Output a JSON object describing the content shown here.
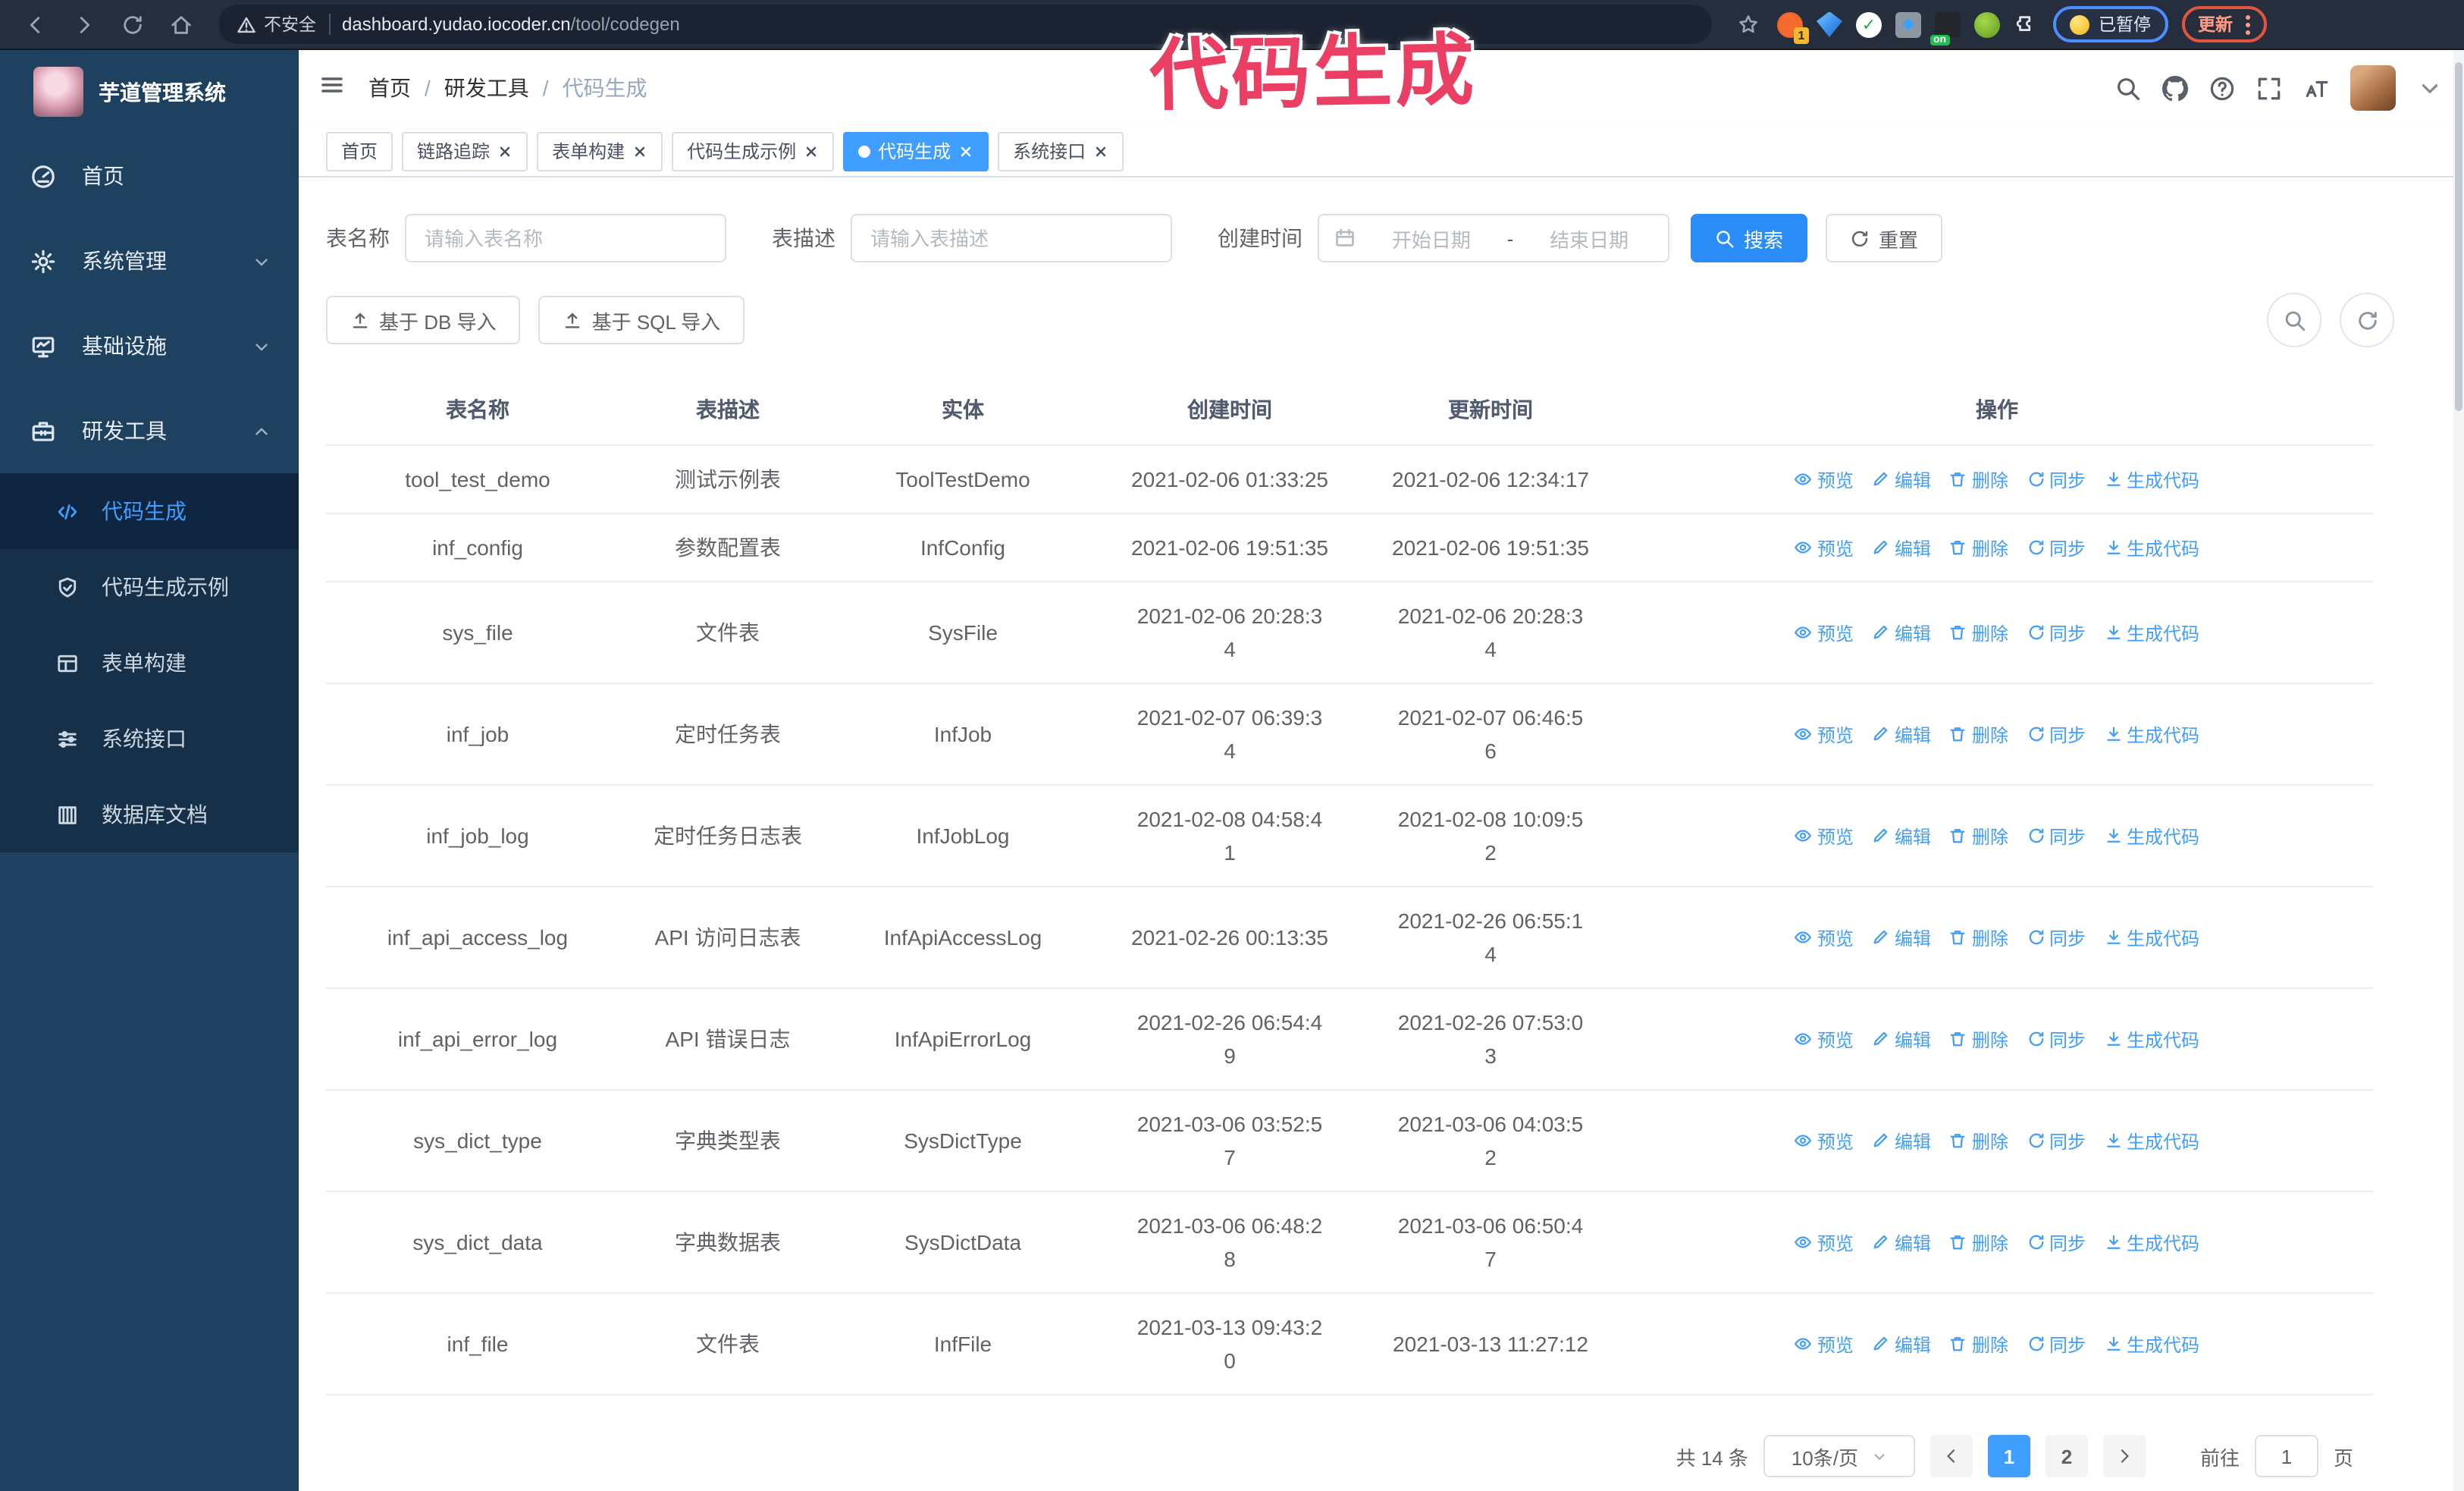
{
  "annotation": {
    "text": "代码生成"
  },
  "browser": {
    "security": "不安全",
    "url_domain": "dashboard.yudao.iocoder.cn",
    "url_path": "/tool/codegen",
    "ext_count_badge": "1",
    "ext_on_badge": "on",
    "paused_label": "已暂停",
    "update_label": "更新"
  },
  "sidebar": {
    "title": "芋道管理系统",
    "items": [
      {
        "label": "首页",
        "icon": "dashboard",
        "chevron": ""
      },
      {
        "label": "系统管理",
        "icon": "gear",
        "chevron": "down"
      },
      {
        "label": "基础设施",
        "icon": "monitor",
        "chevron": "down"
      },
      {
        "label": "研发工具",
        "icon": "toolbox",
        "chevron": "up"
      }
    ],
    "sub_items": [
      {
        "label": "代码生成",
        "icon": "code",
        "active": true
      },
      {
        "label": "代码生成示例",
        "icon": "shield",
        "active": false
      },
      {
        "label": "表单构建",
        "icon": "form",
        "active": false
      },
      {
        "label": "系统接口",
        "icon": "sliders",
        "active": false
      },
      {
        "label": "数据库文档",
        "icon": "database",
        "active": false
      }
    ]
  },
  "breadcrumb": {
    "items": [
      "首页",
      "研发工具",
      "代码生成"
    ],
    "separator": "/"
  },
  "tabs": [
    {
      "label": "首页",
      "closable": false,
      "active": false
    },
    {
      "label": "链路追踪",
      "closable": true,
      "active": false
    },
    {
      "label": "表单构建",
      "closable": true,
      "active": false
    },
    {
      "label": "代码生成示例",
      "closable": true,
      "active": false
    },
    {
      "label": "代码生成",
      "closable": true,
      "active": true
    },
    {
      "label": "系统接口",
      "closable": true,
      "active": false
    }
  ],
  "filters": {
    "name_label": "表名称",
    "name_placeholder": "请输入表名称",
    "desc_label": "表描述",
    "desc_placeholder": "请输入表描述",
    "time_label": "创建时间",
    "start_placeholder": "开始日期",
    "range_separator": "-",
    "end_placeholder": "结束日期",
    "search_label": "搜索",
    "reset_label": "重置"
  },
  "toolbar": {
    "db_import_label": "基于 DB 导入",
    "sql_import_label": "基于 SQL 导入"
  },
  "table": {
    "columns": [
      "表名称",
      "表描述",
      "实体",
      "创建时间",
      "更新时间",
      "操作"
    ],
    "actions": [
      "预览",
      "编辑",
      "删除",
      "同步",
      "生成代码"
    ],
    "rows": [
      {
        "name": "tool_test_demo",
        "desc": "测试示例表",
        "entity": "ToolTestDemo",
        "created": "2021-02-06 01:33:25",
        "updated": "2021-02-06 12:34:17"
      },
      {
        "name": "inf_config",
        "desc": "参数配置表",
        "entity": "InfConfig",
        "created": "2021-02-06 19:51:35",
        "updated": "2021-02-06 19:51:35"
      },
      {
        "name": "sys_file",
        "desc": "文件表",
        "entity": "SysFile",
        "created": "2021-02-06 20:28:3\n4",
        "updated": "2021-02-06 20:28:3\n4"
      },
      {
        "name": "inf_job",
        "desc": "定时任务表",
        "entity": "InfJob",
        "created": "2021-02-07 06:39:3\n4",
        "updated": "2021-02-07 06:46:5\n6"
      },
      {
        "name": "inf_job_log",
        "desc": "定时任务日志表",
        "entity": "InfJobLog",
        "created": "2021-02-08 04:58:4\n1",
        "updated": "2021-02-08 10:09:5\n2"
      },
      {
        "name": "inf_api_access_log",
        "desc": "API 访问日志表",
        "entity": "InfApiAccessLog",
        "created": "2021-02-26 00:13:35",
        "updated": "2021-02-26 06:55:1\n4"
      },
      {
        "name": "inf_api_error_log",
        "desc": "API 错误日志",
        "entity": "InfApiErrorLog",
        "created": "2021-02-26 06:54:4\n9",
        "updated": "2021-02-26 07:53:0\n3"
      },
      {
        "name": "sys_dict_type",
        "desc": "字典类型表",
        "entity": "SysDictType",
        "created": "2021-03-06 03:52:5\n7",
        "updated": "2021-03-06 04:03:5\n2"
      },
      {
        "name": "sys_dict_data",
        "desc": "字典数据表",
        "entity": "SysDictData",
        "created": "2021-03-06 06:48:2\n8",
        "updated": "2021-03-06 06:50:4\n7"
      },
      {
        "name": "inf_file",
        "desc": "文件表",
        "entity": "InfFile",
        "created": "2021-03-13 09:43:2\n0",
        "updated": "2021-03-13 11:27:12"
      }
    ]
  },
  "pagination": {
    "total": "共 14 条",
    "size_label": "10条/页",
    "pages": [
      "1",
      "2"
    ],
    "active_page": "1",
    "goto_label": "前往",
    "goto_value": "1",
    "unit": "页"
  }
}
